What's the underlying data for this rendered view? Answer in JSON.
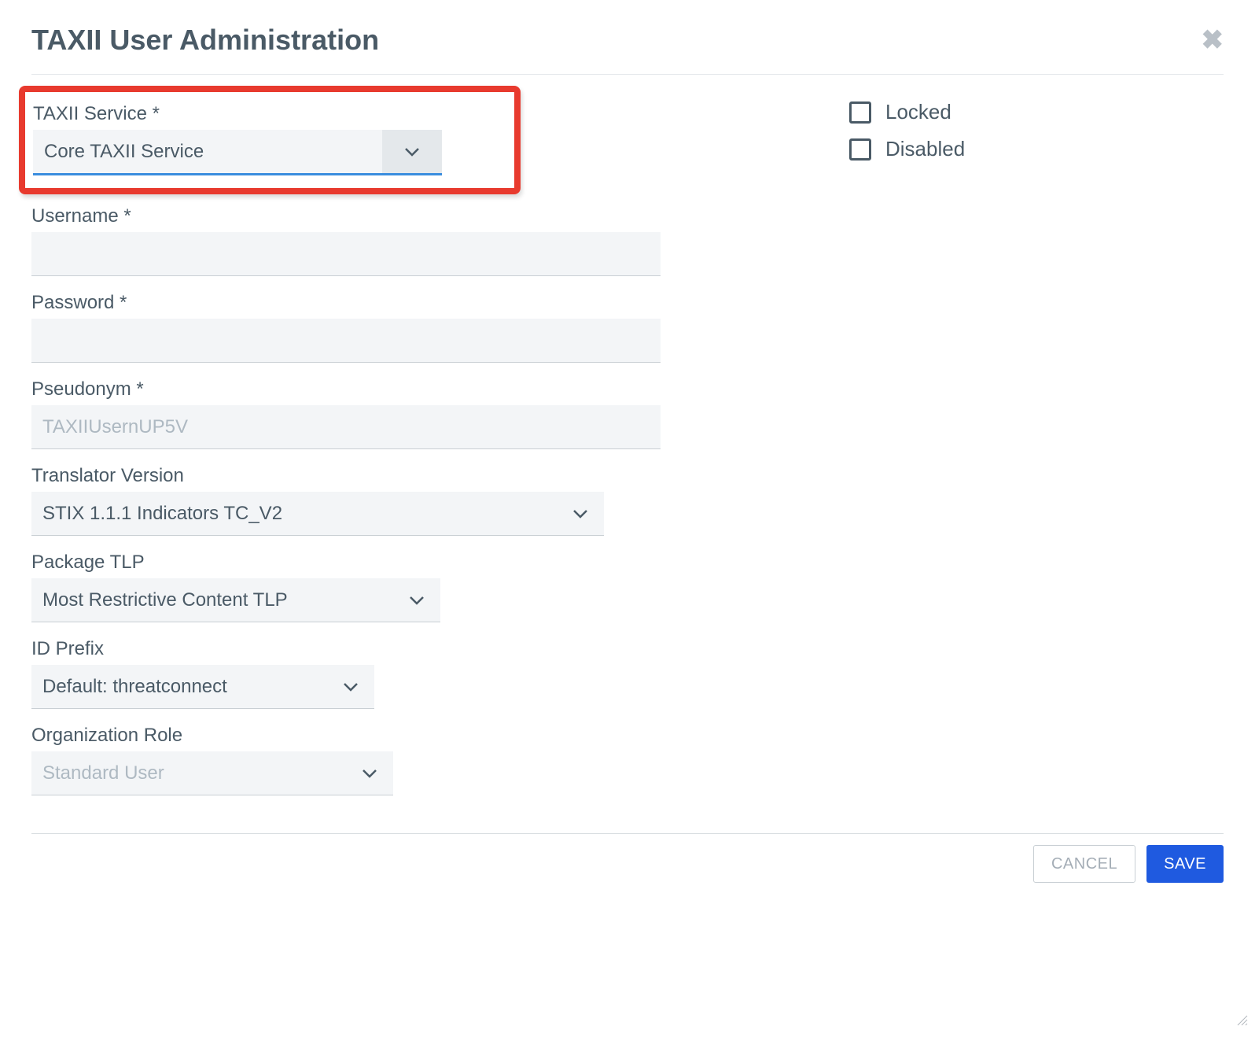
{
  "dialog": {
    "title": "TAXII User Administration"
  },
  "form": {
    "taxii_service": {
      "label": "TAXII Service *",
      "value": "Core TAXII Service"
    },
    "username": {
      "label": "Username *",
      "value": ""
    },
    "password": {
      "label": "Password *",
      "value": ""
    },
    "pseudonym": {
      "label": "Pseudonym *",
      "placeholder": "TAXIIUsernUP5V",
      "value": ""
    },
    "translator_version": {
      "label": "Translator Version",
      "value": "STIX 1.1.1 Indicators TC_V2"
    },
    "package_tlp": {
      "label": "Package TLP",
      "value": "Most Restrictive Content TLP"
    },
    "id_prefix": {
      "label": "ID Prefix",
      "value": "Default: threatconnect"
    },
    "organization_role": {
      "label": "Organization Role",
      "value": "Standard User"
    }
  },
  "checkboxes": {
    "locked": {
      "label": "Locked",
      "checked": false
    },
    "disabled": {
      "label": "Disabled",
      "checked": false
    }
  },
  "buttons": {
    "cancel": "CANCEL",
    "save": "SAVE"
  }
}
